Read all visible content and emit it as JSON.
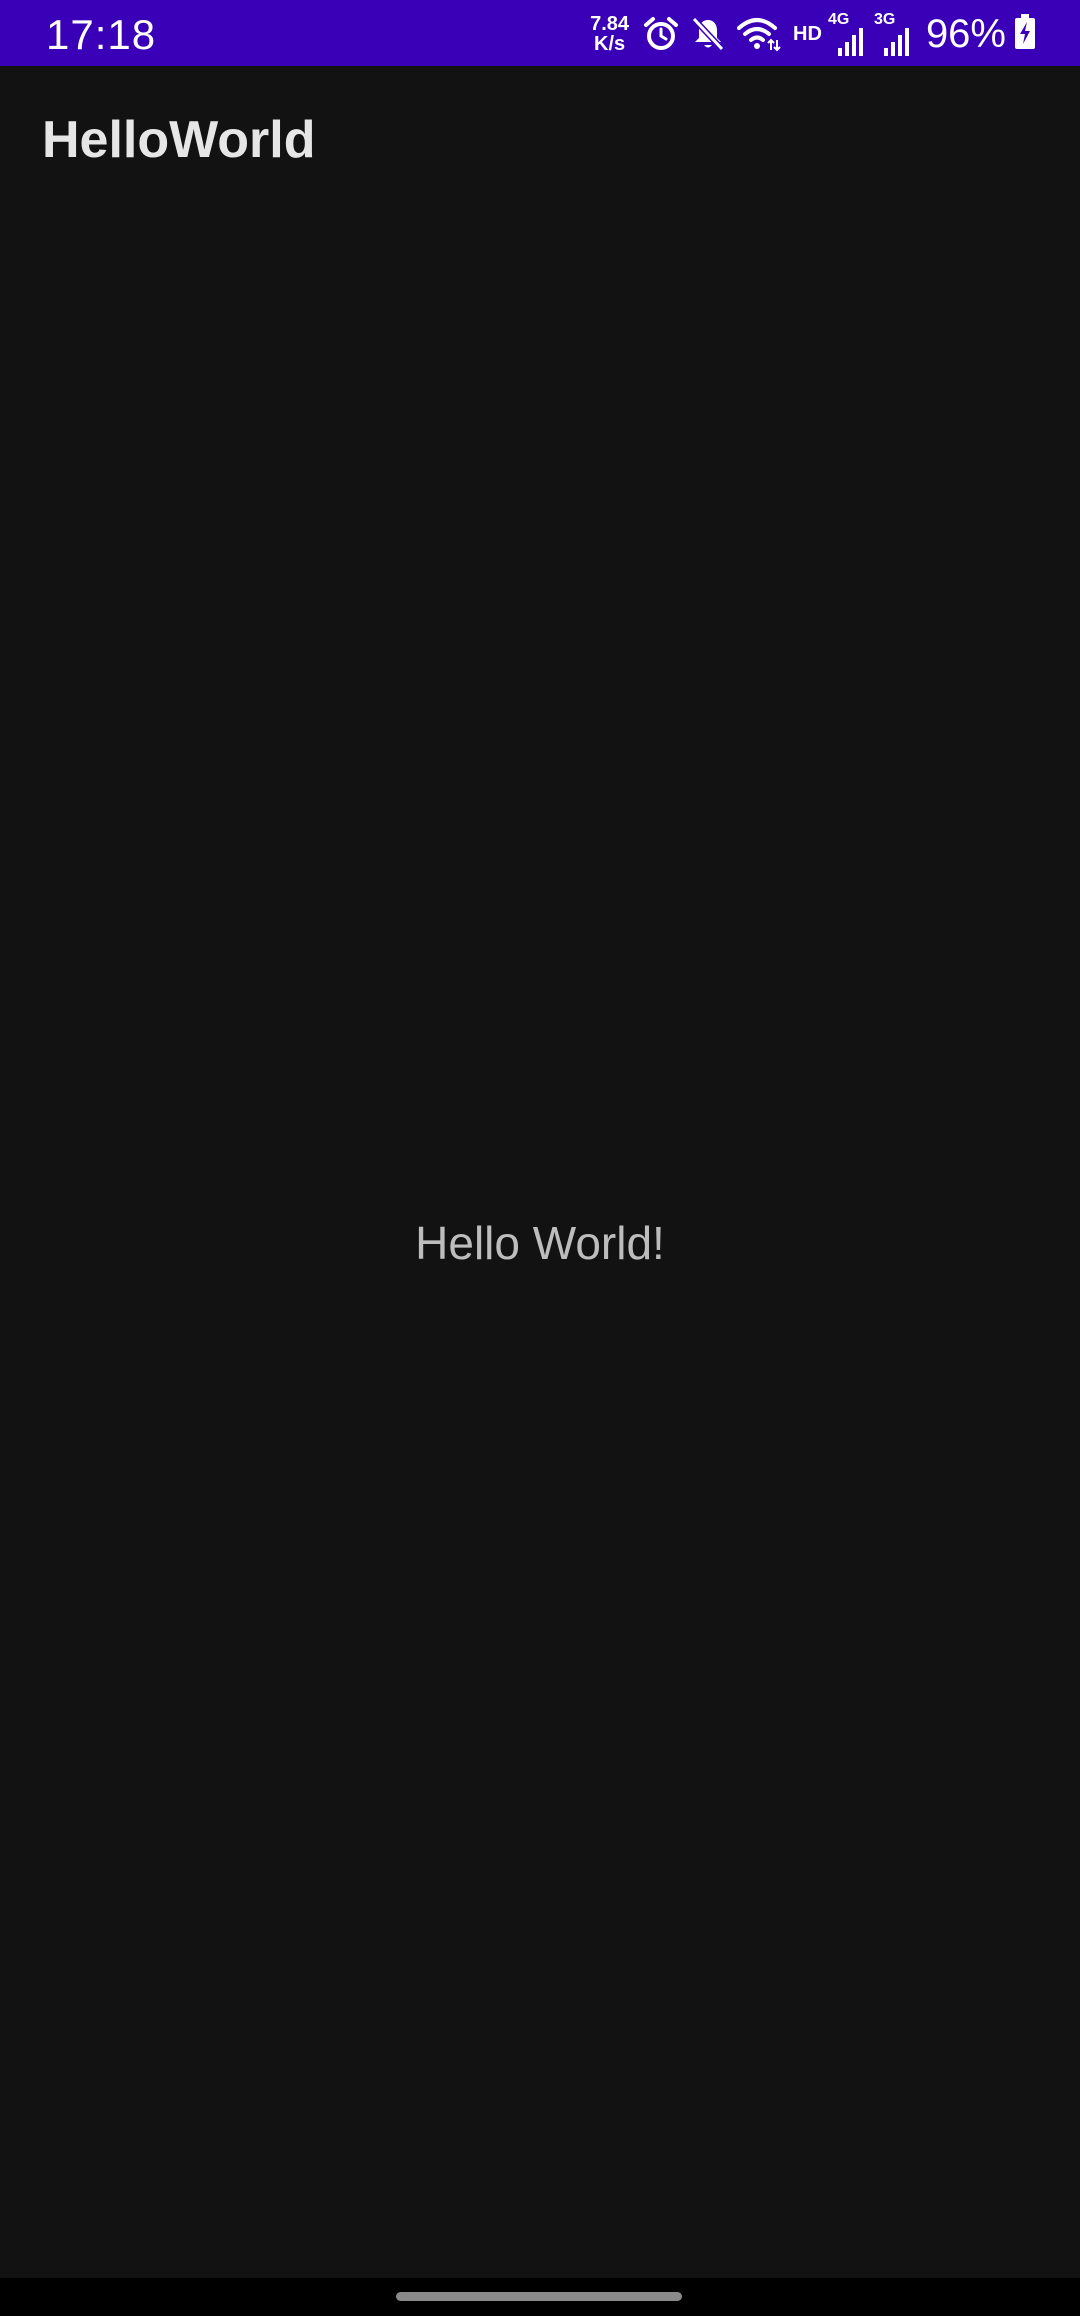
{
  "status_bar": {
    "time": "17:18",
    "net_speed_value": "7.84",
    "net_speed_unit": "K/s",
    "hd_label": "HD",
    "signal1_label": "4G",
    "signal2_label": "3G",
    "battery_percent": "96%",
    "background_color": "#3a00b8",
    "icons": [
      "alarm-icon",
      "mute-icon",
      "wifi-icon",
      "signal-icon",
      "signal-icon",
      "battery-charging-icon"
    ]
  },
  "app": {
    "title": "HelloWorld",
    "content_text": "Hello World!",
    "background_color": "#121212"
  }
}
